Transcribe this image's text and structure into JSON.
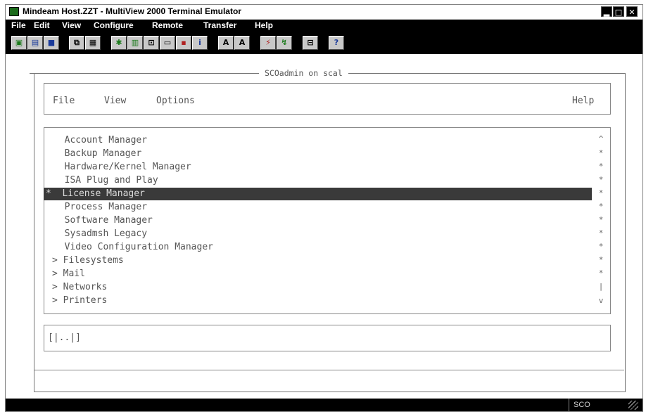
{
  "window": {
    "title": "Mindeam Host.ZZT - MultiView 2000 Terminal Emulator",
    "controls": [
      "minimize-icon",
      "maximize-icon",
      "close-icon"
    ]
  },
  "menubar": {
    "items": [
      "File",
      "Edit",
      "View",
      "Configure",
      "Remote",
      "Transfer",
      "Help"
    ]
  },
  "toolbar": {
    "icons": [
      "connect-icon",
      "open-icon",
      "save-icon",
      "copy-icon",
      "paste-icon",
      "run-icon",
      "print-icon",
      "capture-icon",
      "keyboard-icon",
      "macro-icon",
      "info-icon",
      "font-large-icon",
      "font-small-icon",
      "send-file-icon",
      "receive-file-icon",
      "disconnect-icon",
      "help-icon"
    ]
  },
  "terminal": {
    "frame_title": "SCOadmin on scal",
    "menu": {
      "file": "File",
      "view": "View",
      "options": "Options",
      "help": "Help"
    },
    "list": [
      {
        "marker": " ",
        "label": "Account Manager"
      },
      {
        "marker": " ",
        "label": "Backup Manager"
      },
      {
        "marker": " ",
        "label": "Hardware/Kernel Manager"
      },
      {
        "marker": " ",
        "label": "ISA Plug and Play"
      },
      {
        "marker": "*",
        "label": "License Manager"
      },
      {
        "marker": " ",
        "label": "Process Manager"
      },
      {
        "marker": " ",
        "label": "Software Manager"
      },
      {
        "marker": " ",
        "label": "Sysadmsh Legacy"
      },
      {
        "marker": " ",
        "label": "Video Configuration Manager"
      },
      {
        "marker": ">",
        "label": "Filesystems"
      },
      {
        "marker": ">",
        "label": "Mail"
      },
      {
        "marker": ">",
        "label": "Networks"
      },
      {
        "marker": ">",
        "label": "Printers"
      }
    ],
    "selected_index": 4,
    "scroll_top": "^",
    "scroll_bottom": "v",
    "path": "[|..|]"
  },
  "statusbar": {
    "mode": "SCO"
  }
}
